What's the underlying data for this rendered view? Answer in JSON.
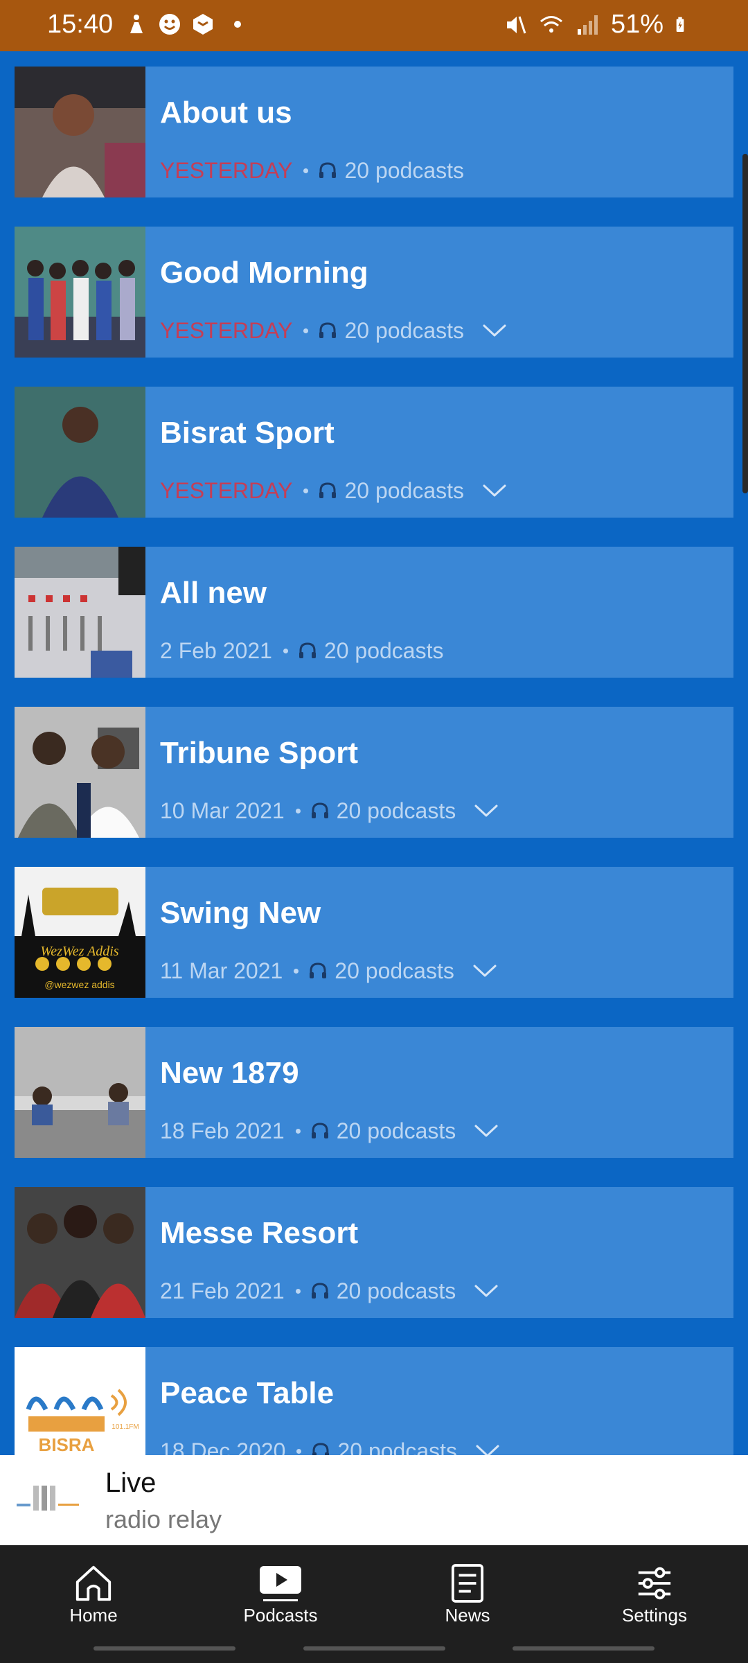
{
  "status_bar": {
    "time": "15:40",
    "battery": "51%"
  },
  "podcasts": [
    {
      "title": "About us",
      "date": "YESTERDAY",
      "recent": true,
      "count": "20 podcasts",
      "chevron": false,
      "thumb": "studio-woman"
    },
    {
      "title": "Good Morning",
      "date": "YESTERDAY",
      "recent": true,
      "count": "20 podcasts",
      "chevron": true,
      "thumb": "group-photo"
    },
    {
      "title": "Bisrat Sport",
      "date": "YESTERDAY",
      "recent": true,
      "count": "20 podcasts",
      "chevron": true,
      "thumb": "man-portrait"
    },
    {
      "title": "All new",
      "date": "2 Feb 2021",
      "recent": false,
      "count": "20 podcasts",
      "chevron": false,
      "thumb": "mixing-console"
    },
    {
      "title": "Tribune Sport",
      "date": "10 Mar 2021",
      "recent": false,
      "count": "20 podcasts",
      "chevron": true,
      "thumb": "two-men"
    },
    {
      "title": "Swing New",
      "date": "11 Mar 2021",
      "recent": false,
      "count": "20 podcasts",
      "chevron": true,
      "thumb": "wezwez-logo",
      "thumb_text": "WezWez Addis",
      "thumb_sub": "@wezwez addis"
    },
    {
      "title": "New 1879",
      "date": "18 Feb 2021",
      "recent": false,
      "count": "20 podcasts",
      "chevron": true,
      "thumb": "radio-studio"
    },
    {
      "title": "Messe Resort",
      "date": "21 Feb 2021",
      "recent": false,
      "count": "20 podcasts",
      "chevron": true,
      "thumb": "cast-group"
    },
    {
      "title": "Peace Table",
      "date": "18 Dec 2020",
      "recent": false,
      "count": "20 podcasts",
      "chevron": true,
      "thumb": "bisrat-logo",
      "thumb_text": "BISRA",
      "thumb_sub": "101.1FM"
    }
  ],
  "mini_player": {
    "title": "Live",
    "subtitle": "radio relay"
  },
  "bottom_nav": [
    {
      "label": "Home",
      "icon": "home-icon",
      "active": false
    },
    {
      "label": "Podcasts",
      "icon": "play-icon",
      "active": true
    },
    {
      "label": "News",
      "icon": "news-icon",
      "active": false
    },
    {
      "label": "Settings",
      "icon": "settings-icon",
      "active": false
    }
  ],
  "colors": {
    "background": "#0b66c4",
    "card": "#3a87d6",
    "status_bar": "#a7570f",
    "recent_date": "#c43e56",
    "nav_bar": "#1f1f1f"
  }
}
